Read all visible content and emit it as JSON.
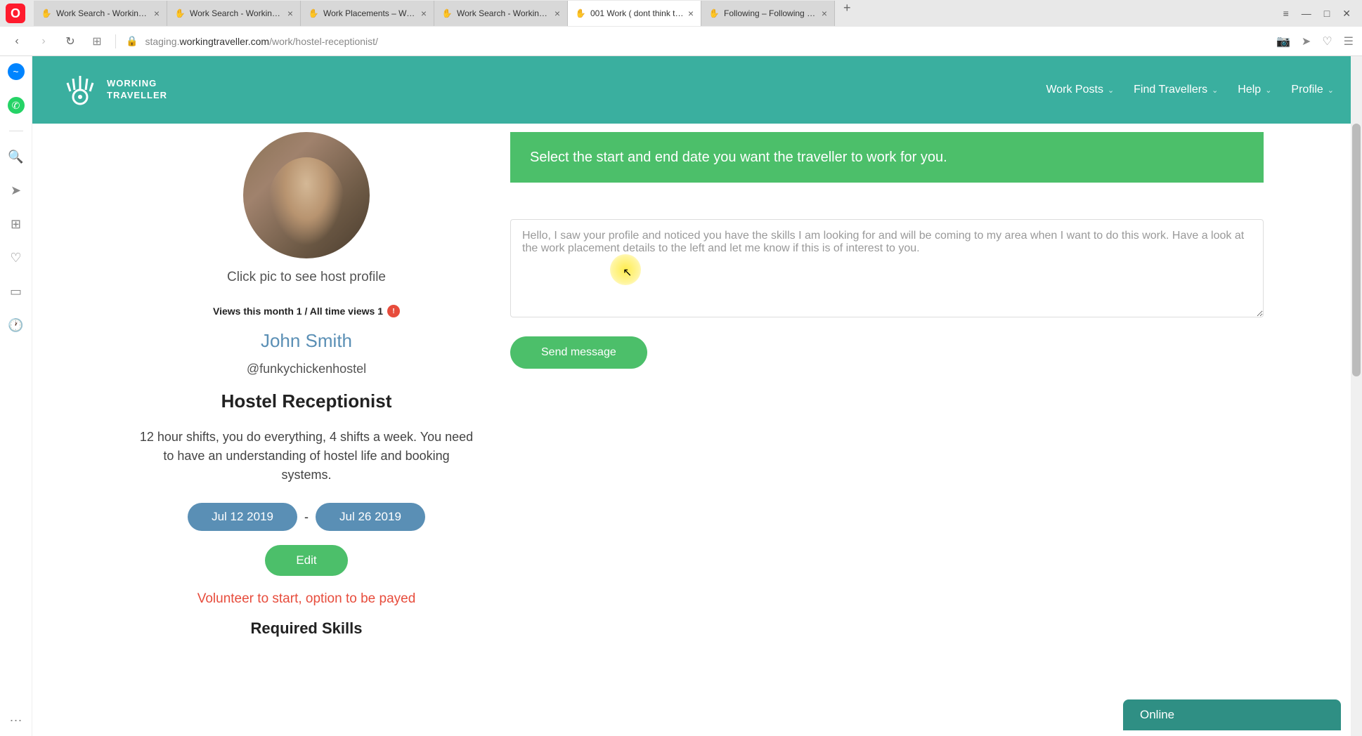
{
  "browser": {
    "tabs": [
      {
        "title": "Work Search - Working Tra",
        "active": false
      },
      {
        "title": "Work Search - Working Tra",
        "active": false
      },
      {
        "title": "Work Placements – Work P",
        "active": false
      },
      {
        "title": "Work Search - Working Tra",
        "active": false
      },
      {
        "title": "001 Work ( dont think this",
        "active": true
      },
      {
        "title": "Following – Following – Jo",
        "active": false
      }
    ],
    "url_prefix": "staging.",
    "url_domain": "workingtraveller.com",
    "url_path": "/work/hostel-receptionist/"
  },
  "header": {
    "logo_line1": "WORKING",
    "logo_line2": "TRAVELLER",
    "nav": [
      "Work Posts",
      "Find Travellers",
      "Help",
      "Profile"
    ]
  },
  "profile": {
    "caption": "Click pic to see host profile",
    "views_text": "Views this month 1 / All time views 1",
    "views_badge": "!",
    "host_name": "John Smith",
    "handle": "@funkychickenhostel",
    "job_title": "Hostel Receptionist",
    "description": "12 hour shifts, you do everything, 4 shifts a week. You need to have an understanding of hostel life and booking systems.",
    "date_start": "Jul 12 2019",
    "date_end": "Jul 26 2019",
    "edit_label": "Edit",
    "volunteer_text": "Volunteer to start, option to be payed",
    "skills_heading": "Required Skills"
  },
  "message": {
    "banner_text": "Select the start and end date you want the traveller to work for you.",
    "placeholder": "Hello, I saw your profile and noticed you have the skills I am looking for and will be coming to my area when I want to do this work. Have a look at the work placement details to the left and let me know if this is of interest to you.",
    "send_label": "Send message"
  },
  "chat": {
    "status": "Online"
  }
}
